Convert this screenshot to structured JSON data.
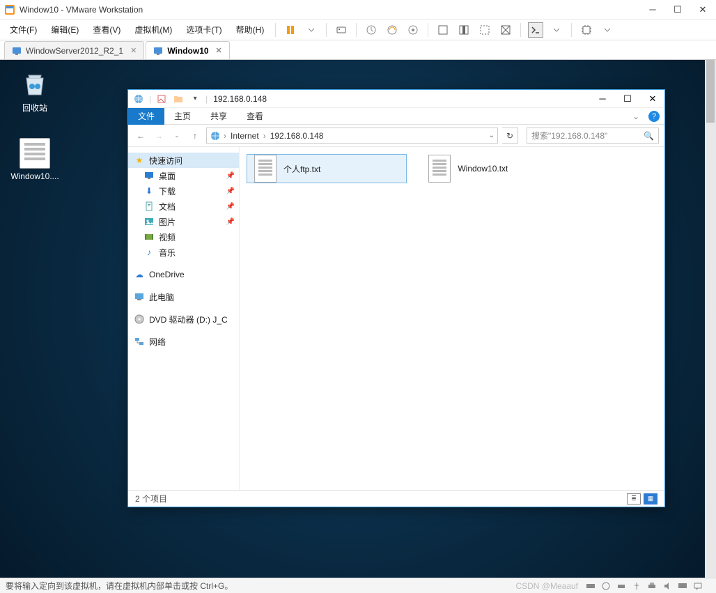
{
  "vmware": {
    "title": "Window10 - VMware Workstation",
    "menus": [
      "文件(F)",
      "编辑(E)",
      "查看(V)",
      "虚拟机(M)",
      "选项卡(T)",
      "帮助(H)"
    ],
    "tabs": [
      {
        "label": "WindowServer2012_R2_1",
        "active": false
      },
      {
        "label": "Window10",
        "active": true
      }
    ],
    "status_hint": "要将输入定向到该虚拟机，请在虚拟机内部单击或按 Ctrl+G。",
    "watermark": "CSDN @Meaauf"
  },
  "desktop": {
    "icons": [
      {
        "label": "回收站",
        "type": "recycle"
      },
      {
        "label": "Window10....",
        "type": "txtfile"
      }
    ]
  },
  "explorer": {
    "title": "192.168.0.148",
    "ribbon": {
      "file": "文件",
      "tabs": [
        "主页",
        "共享",
        "查看"
      ]
    },
    "breadcrumb": [
      "Internet",
      "192.168.0.148"
    ],
    "search_placeholder": "搜索\"192.168.0.148\"",
    "sidebar": {
      "quick_access": "快速访问",
      "items": [
        {
          "label": "桌面",
          "pin": true,
          "icon": "desktop"
        },
        {
          "label": "下载",
          "pin": true,
          "icon": "download"
        },
        {
          "label": "文档",
          "pin": true,
          "icon": "docs"
        },
        {
          "label": "图片",
          "pin": true,
          "icon": "pictures"
        },
        {
          "label": "视频",
          "pin": false,
          "icon": "video"
        },
        {
          "label": "音乐",
          "pin": false,
          "icon": "music"
        }
      ],
      "roots": [
        {
          "label": "OneDrive",
          "icon": "cloud"
        },
        {
          "label": "此电脑",
          "icon": "pc"
        },
        {
          "label": "DVD 驱动器 (D:) J_C",
          "icon": "dvd"
        },
        {
          "label": "网络",
          "icon": "network"
        }
      ]
    },
    "files": [
      {
        "name": "个人ftp.txt",
        "selected": true
      },
      {
        "name": "Window10.txt",
        "selected": false
      }
    ],
    "status": "2 个项目"
  }
}
